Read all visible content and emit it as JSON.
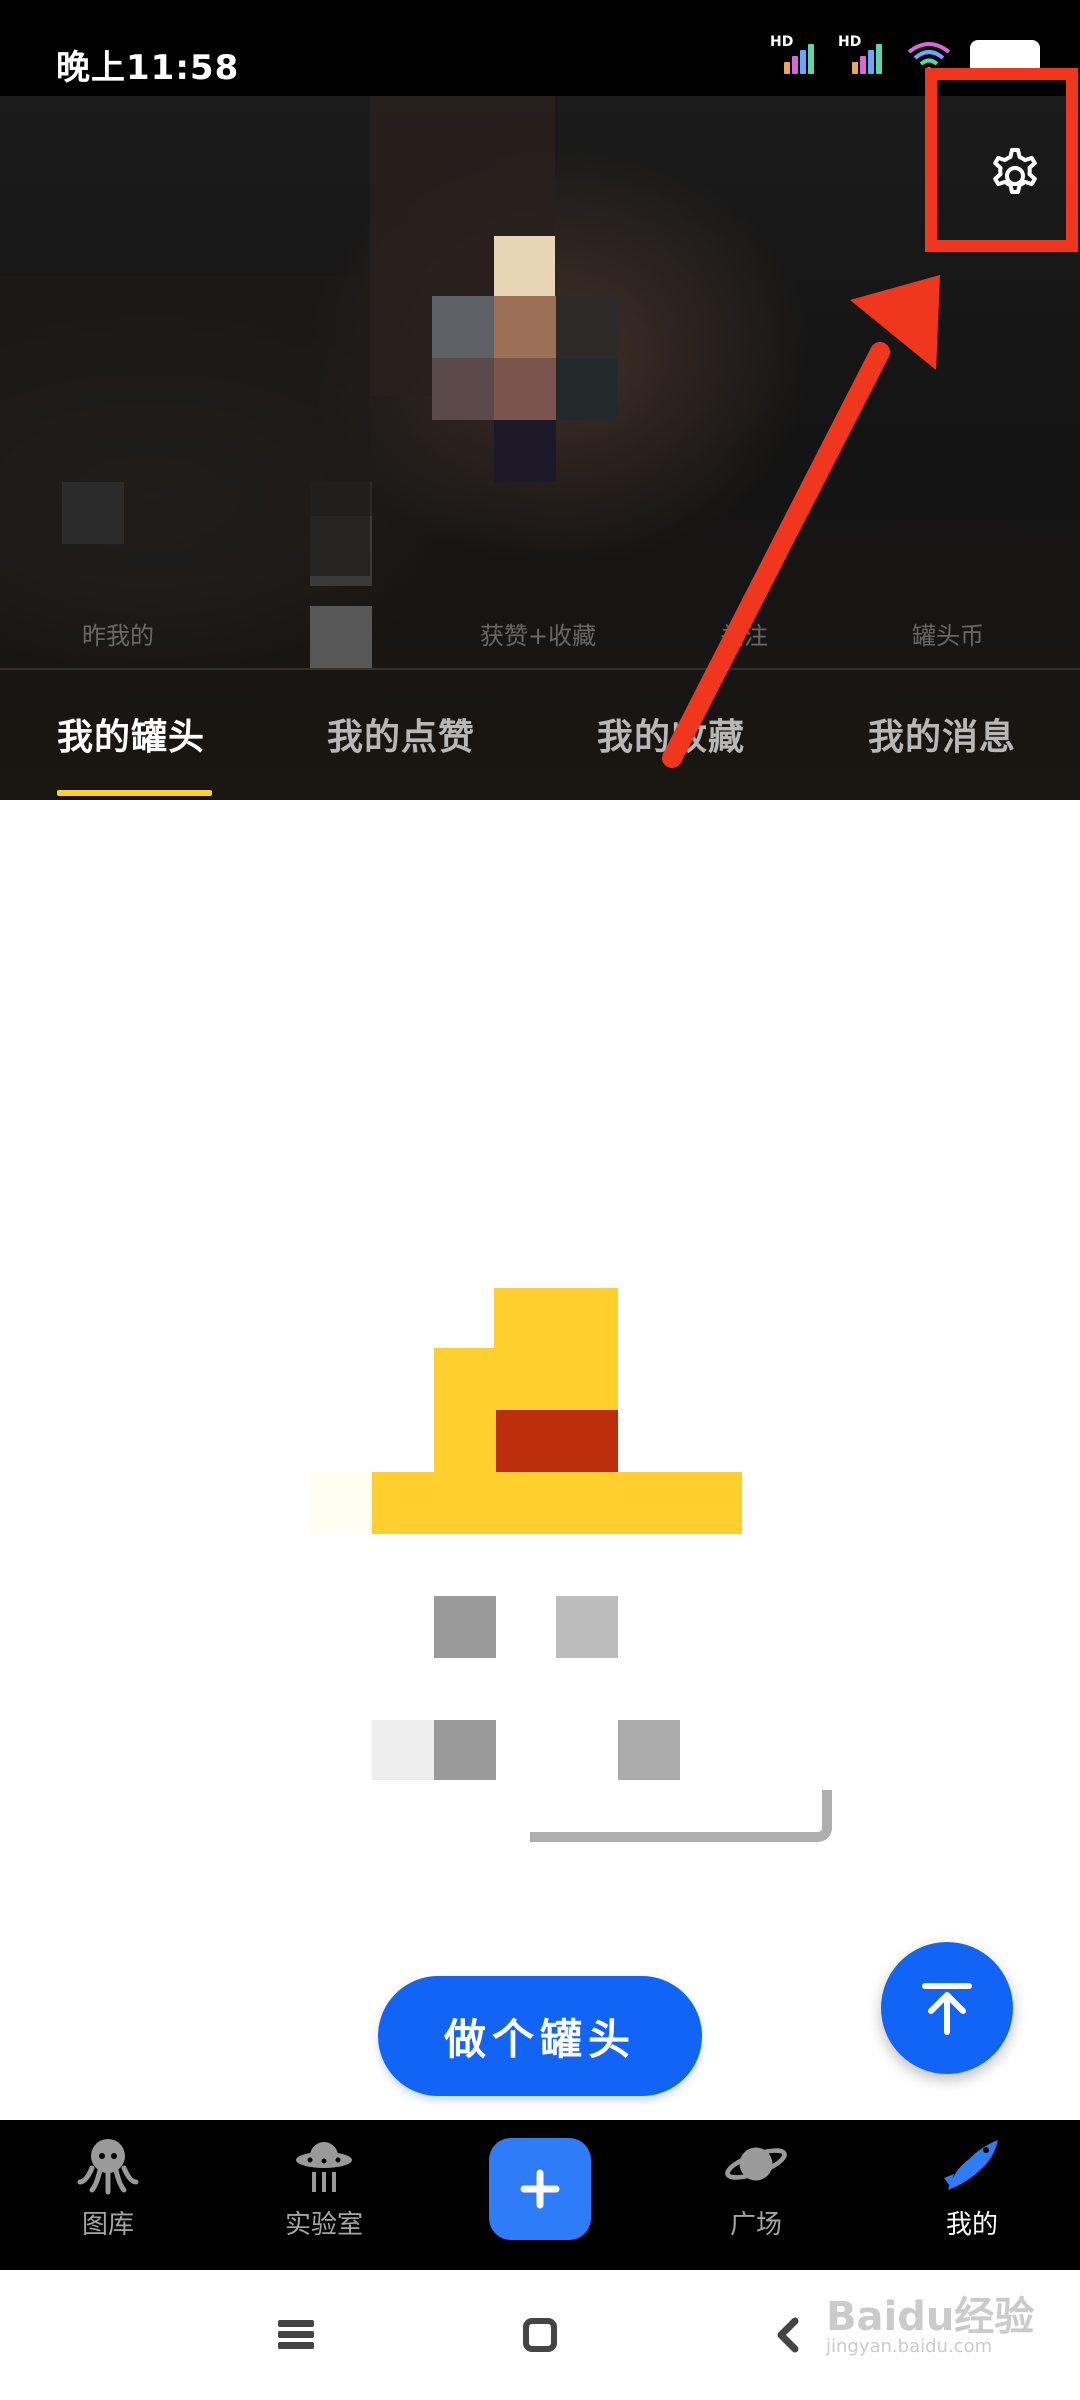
{
  "status_bar": {
    "time": "晚上11:58",
    "signal_1_label": "HD",
    "signal_2_label": "HD",
    "icons": [
      "signal-icon",
      "signal-icon",
      "wifi-icon",
      "battery-icon"
    ]
  },
  "header": {
    "settings_icon": "gear-icon",
    "stats_partial": [
      "昨我的",
      "获赞+收藏",
      "关注",
      "罐头币"
    ],
    "tabs": [
      {
        "label": "我的罐头",
        "active": true
      },
      {
        "label": "我的点赞",
        "active": false
      },
      {
        "label": "我的收藏",
        "active": false
      },
      {
        "label": "我的消息",
        "active": false
      }
    ]
  },
  "main": {
    "make_button_label": "做个罐头",
    "back_to_top_icon": "arrow-up-icon"
  },
  "bottom_nav": {
    "items": [
      {
        "label": "图库",
        "icon": "octopus-icon",
        "active": false
      },
      {
        "label": "实验室",
        "icon": "ufo-icon",
        "active": false
      },
      {
        "label": "广场",
        "icon": "planet-icon",
        "active": false
      },
      {
        "label": "我的",
        "icon": "fish-icon",
        "active": true
      }
    ],
    "add_icon": "plus-icon"
  },
  "system_nav": {
    "icons": [
      "menu-icon",
      "home-icon",
      "back-icon"
    ]
  },
  "watermark": {
    "text": "Baidu经验",
    "sub": "jingyan.baidu.com"
  },
  "colors": {
    "accent_blue": "#1264f6",
    "tab_indicator": "#ffcf2e",
    "annotation_red": "#f0371e",
    "header_bg": "#0c0c0c"
  }
}
